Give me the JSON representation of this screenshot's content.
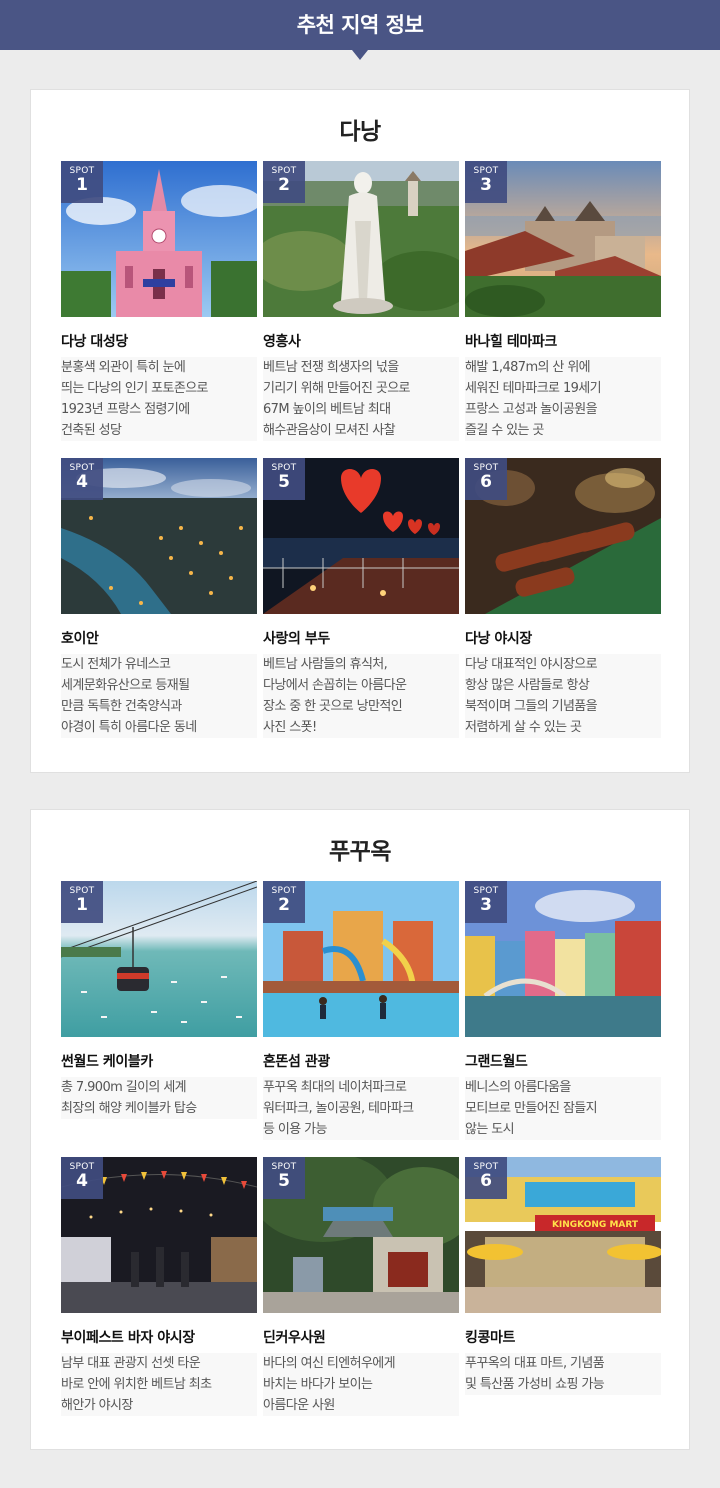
{
  "header": {
    "title": "추천 지역 정보"
  },
  "regions": [
    {
      "title": "다낭",
      "spots": [
        {
          "label": "SPOT",
          "num": "1",
          "name": "다낭 대성당",
          "desc": "분홍색 외관이 특히 눈에\n띄는 다낭의 인기 포토존으로\n1923년 프랑스 점령기에\n건축된 성당"
        },
        {
          "label": "SPOT",
          "num": "2",
          "name": "영흥사",
          "desc": "베트남 전쟁 희생자의 넋을\n기리기 위해 만들어진 곳으로\n67M 높이의 베트남 최대\n해수관음상이 모셔진 사찰"
        },
        {
          "label": "SPOT",
          "num": "3",
          "name": "바나힐 테마파크",
          "desc": "해발 1,487m의 산 위에\n세워진 테마파크로 19세기\n프랑스 고성과 놀이공원을\n즐길 수 있는 곳"
        },
        {
          "label": "SPOT",
          "num": "4",
          "name": "호이안",
          "desc": "도시 전체가 유네스코\n세계문화유산으로 등재될\n만큼 독특한 건축양식과\n야경이 특히 아름다운 동네"
        },
        {
          "label": "SPOT",
          "num": "5",
          "name": "사랑의 부두",
          "desc": "베트남 사람들의 휴식처,\n다낭에서 손꼽히는 아름다운\n장소 중 한 곳으로 낭만적인\n사진 스폿!"
        },
        {
          "label": "SPOT",
          "num": "6",
          "name": "다낭 야시장",
          "desc": "다낭 대표적인 야시장으로\n항상 많은 사람들로 항상\n북적이며 그들의 기념품을\n저렴하게 살 수 있는 곳"
        }
      ]
    },
    {
      "title": "푸꾸옥",
      "spots": [
        {
          "label": "SPOT",
          "num": "1",
          "name": "썬월드 케이블카",
          "desc": "총 7.900m 길이의 세계\n최장의 해양 케이블카 탑승"
        },
        {
          "label": "SPOT",
          "num": "2",
          "name": "혼똔섬 관광",
          "desc": "푸꾸옥 최대의 네이처파크로\n워터파크, 놀이공원, 테마파크\n등 이용 가능"
        },
        {
          "label": "SPOT",
          "num": "3",
          "name": "그랜드월드",
          "desc": "베니스의 아름다움을\n모티브로 만들어진 잠들지\n않는 도시"
        },
        {
          "label": "SPOT",
          "num": "4",
          "name": "부이페스트 바자 야시장",
          "desc": "남부 대표 관광지 선셋 타운\n바로 안에 위치한 베트남 최초\n해안가 야시장"
        },
        {
          "label": "SPOT",
          "num": "5",
          "name": "딘커우사원",
          "desc": "바다의 여신 티엔허우에게\n바치는 바다가 보이는\n아름다운 사원"
        },
        {
          "label": "SPOT",
          "num": "6",
          "name": "킹콩마트",
          "desc": "푸꾸옥의 대표 마트, 기념품\n및 특산품 가성비 쇼핑 가능",
          "sign_text": "KINGKONG MART"
        }
      ]
    }
  ]
}
